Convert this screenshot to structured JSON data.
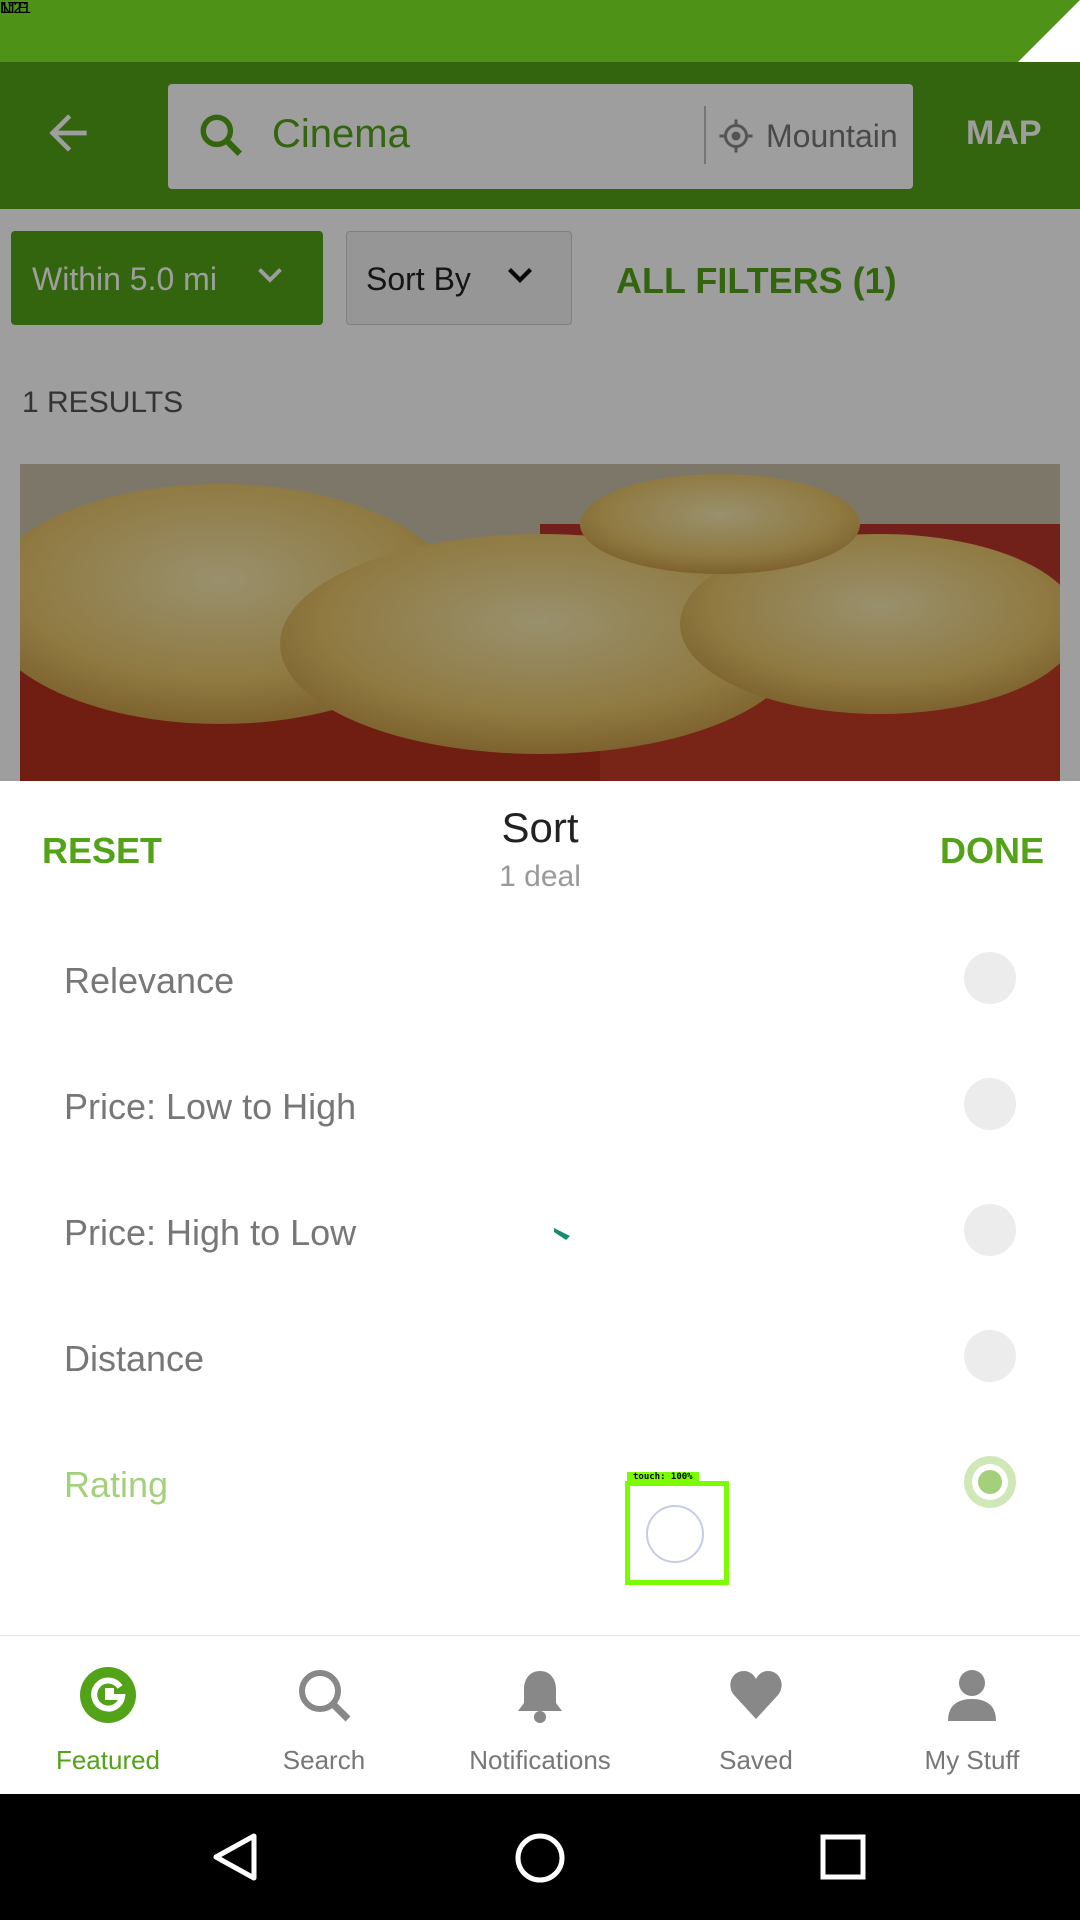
{
  "status_bar": {
    "network": "LTE",
    "time": "1:21"
  },
  "app_bar": {
    "search_query": "Cinema",
    "location": "Mountain",
    "map_label": "MAP"
  },
  "filters": {
    "distance": "Within 5.0 mi",
    "sort": "Sort By",
    "all_filters": "ALL FILTERS (1)"
  },
  "results": {
    "count_label": "1 RESULTS"
  },
  "sort_sheet": {
    "reset_label": "RESET",
    "title": "Sort",
    "subtitle": "1 deal",
    "done_label": "DONE",
    "options": [
      {
        "label": "Relevance",
        "selected": false
      },
      {
        "label": "Price: Low to High",
        "selected": false
      },
      {
        "label": "Price: High to Low",
        "selected": false
      },
      {
        "label": "Distance",
        "selected": false
      },
      {
        "label": "Rating",
        "selected": true
      }
    ]
  },
  "touch_indicator": {
    "label": "touch: 100%"
  },
  "bottom_nav": [
    {
      "label": "Featured",
      "icon": "groupon-g-icon",
      "active": true
    },
    {
      "label": "Search",
      "icon": "search-icon",
      "active": false
    },
    {
      "label": "Notifications",
      "icon": "bell-icon",
      "active": false
    },
    {
      "label": "Saved",
      "icon": "heart-icon",
      "active": false
    },
    {
      "label": "My Stuff",
      "icon": "person-icon",
      "active": false
    }
  ],
  "colors": {
    "brand_green": "#53a318",
    "status_green": "#4f9218",
    "selected_light_green": "#a4d07c"
  }
}
